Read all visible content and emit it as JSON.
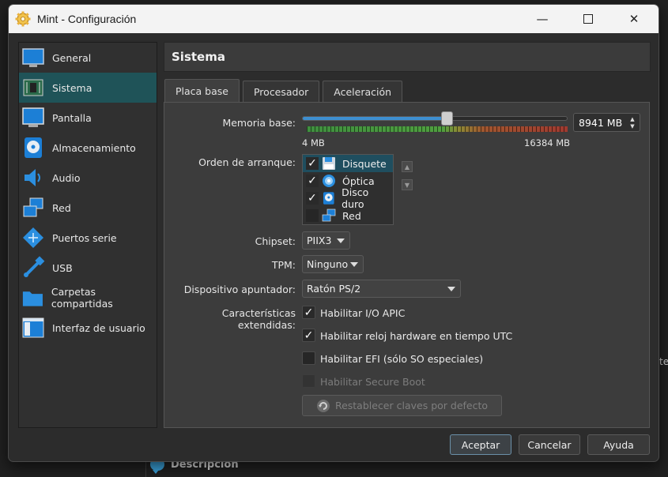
{
  "window": {
    "title": "Mint - Configuración"
  },
  "sidebar": {
    "items": [
      {
        "label": "General",
        "icon": "monitor-icon"
      },
      {
        "label": "Sistema",
        "icon": "chip-icon",
        "selected": true
      },
      {
        "label": "Pantalla",
        "icon": "display-icon"
      },
      {
        "label": "Almacenamiento",
        "icon": "disk-icon"
      },
      {
        "label": "Audio",
        "icon": "speaker-icon"
      },
      {
        "label": "Red",
        "icon": "network-icon"
      },
      {
        "label": "Puertos serie",
        "icon": "serial-port-icon"
      },
      {
        "label": "USB",
        "icon": "usb-icon"
      },
      {
        "label": "Carpetas compartidas",
        "icon": "folder-icon"
      },
      {
        "label": "Interfaz de usuario",
        "icon": "ui-window-icon"
      }
    ]
  },
  "section": {
    "title": "Sistema"
  },
  "tabs": [
    {
      "label": "Placa base",
      "active": true
    },
    {
      "label": "Procesador"
    },
    {
      "label": "Aceleración"
    }
  ],
  "memory": {
    "label": "Memoria base:",
    "value": "8941 MB",
    "min_label": "4 MB",
    "max_label": "16384 MB",
    "fraction": 0.546
  },
  "boot": {
    "label": "Orden de arranque:",
    "items": [
      {
        "label": "Disquete",
        "checked": true,
        "selected": true,
        "icon": "floppy-icon"
      },
      {
        "label": "Óptica",
        "checked": true,
        "icon": "optical-disc-icon"
      },
      {
        "label": "Disco duro",
        "checked": true,
        "icon": "hard-disk-icon"
      },
      {
        "label": "Red",
        "checked": false,
        "icon": "network-icon"
      }
    ]
  },
  "chipset": {
    "label": "Chipset:",
    "value": "PIIX3"
  },
  "tpm": {
    "label": "TPM:",
    "value": "Ninguno"
  },
  "pointing": {
    "label": "Dispositivo apuntador:",
    "value": "Ratón PS/2"
  },
  "extended": {
    "label": "Características extendidas:",
    "options": [
      {
        "label": "Habilitar I/O APIC",
        "checked": true,
        "enabled": true
      },
      {
        "label": "Habilitar reloj hardware en tiempo UTC",
        "checked": true,
        "enabled": true
      },
      {
        "label": "Habilitar EFI (sólo SO especiales)",
        "checked": false,
        "enabled": true
      },
      {
        "label": "Habilitar Secure Boot",
        "checked": false,
        "enabled": false
      }
    ]
  },
  "reset_keys": {
    "label": "Restablecer claves por defecto"
  },
  "buttons": {
    "accept": "Aceptar",
    "cancel": "Cancelar",
    "help": "Ayuda"
  },
  "background": {
    "description_label": "Descripción",
    "partial_text": "te"
  },
  "colors": {
    "accent": "#1f5358",
    "slider": "#3d8fd1",
    "titlebar": "#f3f3f3"
  }
}
